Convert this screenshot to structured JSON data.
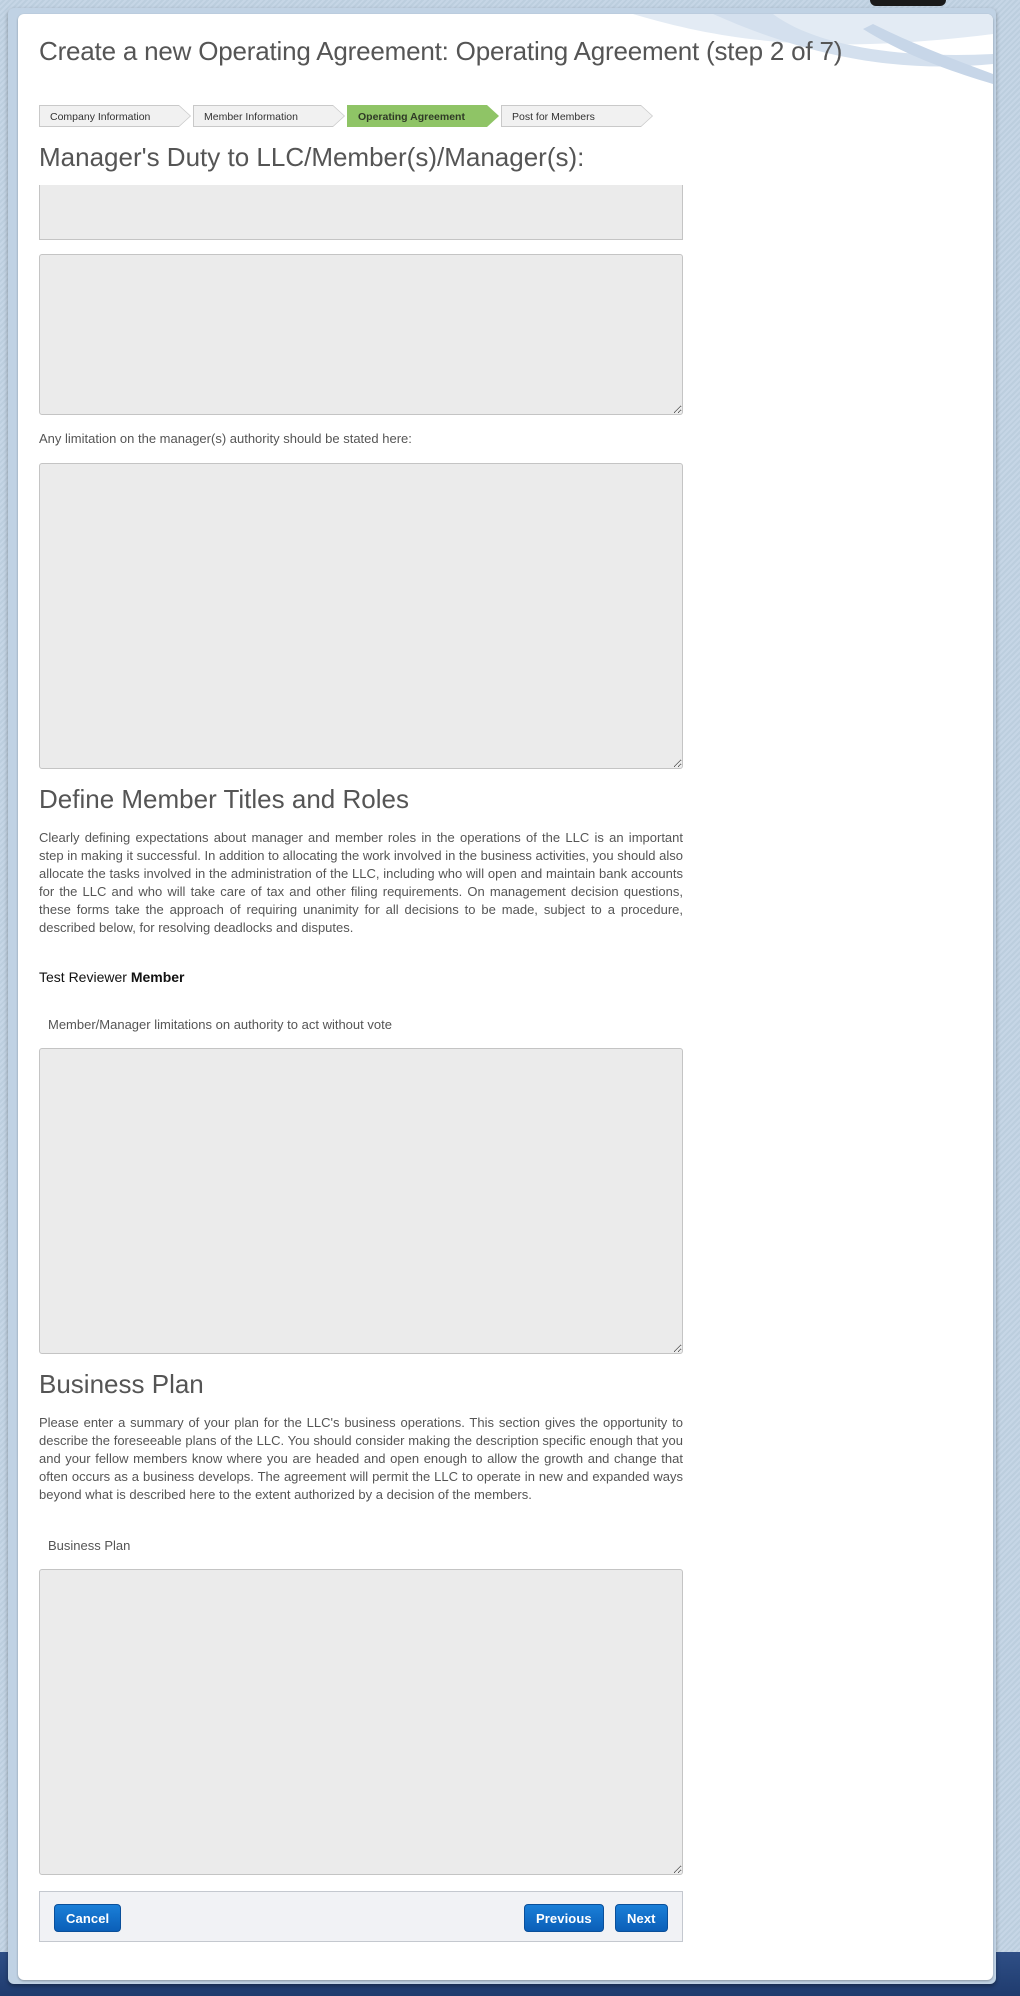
{
  "dialog": {
    "title": "Create a new Operating Agreement: Operating Agreement (step 2 of 7)"
  },
  "steps": [
    {
      "label": "Company Information",
      "active": false
    },
    {
      "label": "Member Information",
      "active": false
    },
    {
      "label": "Operating Agreement",
      "active": true
    },
    {
      "label": "Post for Members",
      "active": false
    }
  ],
  "sections": {
    "manager_duty": {
      "heading": "Manager's Duty to LLC/Member(s)/Manager(s):",
      "field1_value": "",
      "field2_value": "",
      "limitation_label": "Any limitation on the manager(s) authority should be stated here:",
      "limitation_value": ""
    },
    "member_roles": {
      "heading": "Define Member Titles and Roles",
      "description": "Clearly defining expectations about manager and member roles in the operations of the LLC is an important step in making it successful. In addition to allocating the work involved in the business activities, you should also allocate the tasks involved in the administration of the LLC, including who will open and maintain bank accounts for the LLC and who will take care of tax and other filing requirements. On management decision questions, these forms take the approach of requiring unanimity for all decisions to be made, subject to a procedure, described below, for resolving deadlocks and disputes.",
      "member_name": "Test Reviewer",
      "member_role": "Member",
      "limitation_label": "Member/Manager limitations on authority to act without vote",
      "limitation_value": ""
    },
    "business_plan": {
      "heading": "Business Plan",
      "description": "Please enter a summary of your plan for the LLC's business operations. This section gives the opportunity to describe the foreseeable plans of the LLC. You should consider making the description specific enough that you and your fellow members know where you are headed and open enough to allow the growth and change that often occurs as a business develops. The agreement will permit the LLC to operate in new and expanded ways beyond what is described here to the extent authorized by a decision of the members.",
      "field_label": "Business Plan",
      "field_value": ""
    }
  },
  "footer": {
    "cancel_label": "Cancel",
    "previous_label": "Previous",
    "next_label": "Next"
  },
  "colors": {
    "active_step": "#8fc466",
    "button_blue": "#0b6cc8",
    "textarea_bg": "#ebebeb"
  }
}
